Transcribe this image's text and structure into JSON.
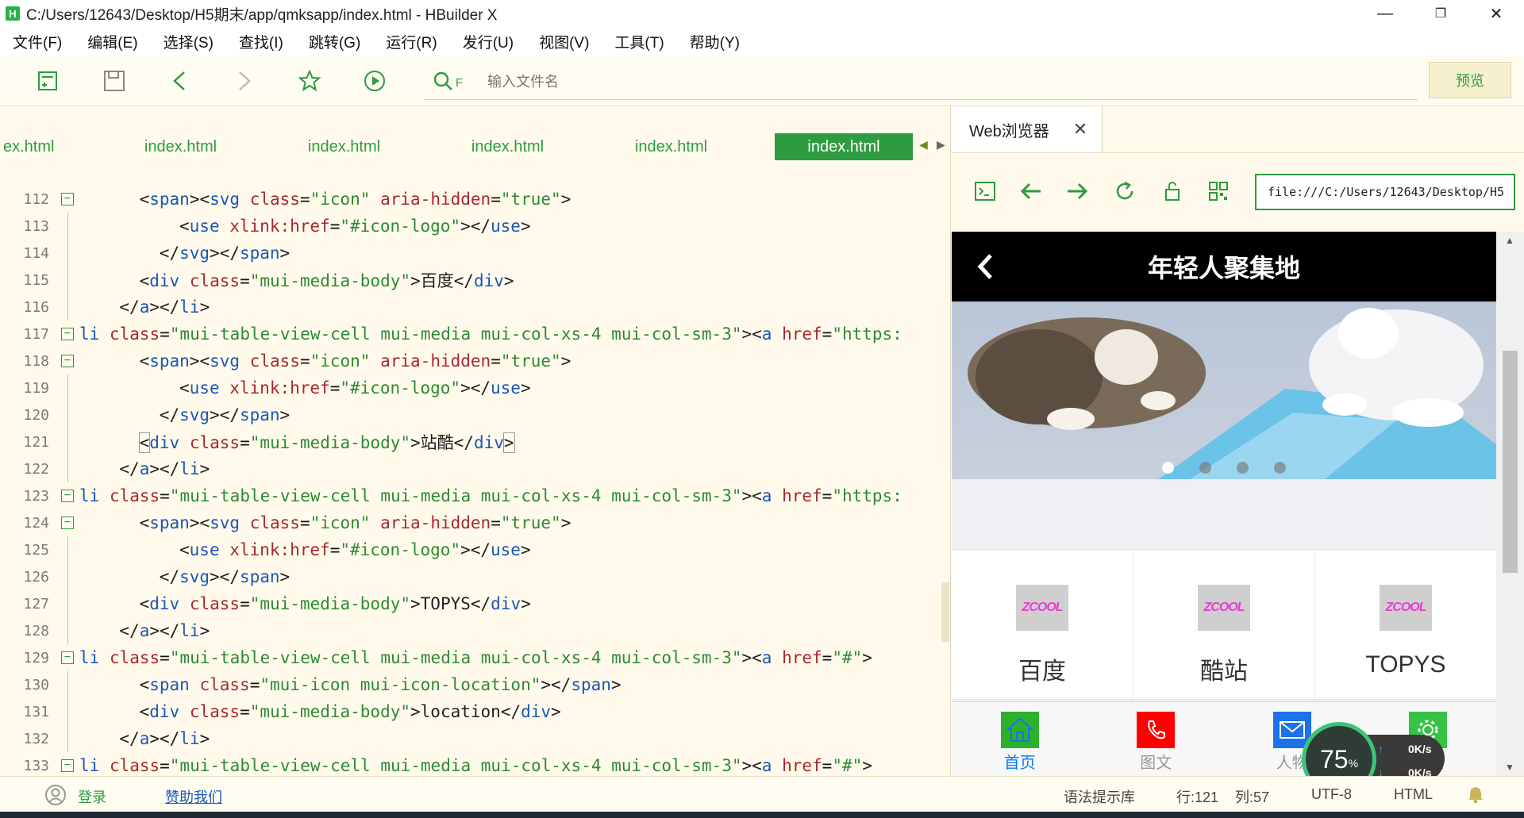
{
  "window": {
    "title": "C:/Users/12643/Desktop/H5期末/app/qmksapp/index.html - HBuilder X",
    "minimize": "—",
    "restore": "❐",
    "close": "✕"
  },
  "menu": [
    "文件(F)",
    "编辑(E)",
    "选择(S)",
    "查找(I)",
    "跳转(G)",
    "运行(R)",
    "发行(U)",
    "视图(V)",
    "工具(T)",
    "帮助(Y)"
  ],
  "toolbar": {
    "search_icon_text": "F",
    "search_placeholder": "输入文件名",
    "preview_label": "预览"
  },
  "tabs": [
    "ex.html",
    "index.html",
    "index.html",
    "index.html",
    "index.html",
    "index.html"
  ],
  "active_tab_index": 5,
  "code_lines": [
    {
      "n": "112",
      "fold": "−",
      "indent": 3,
      "html": "<span class=\"p\">&lt;</span><span class=\"t\">span</span><span class=\"p\">&gt;&lt;</span><span class=\"t\">svg</span> <span class=\"a\">class</span>=<span class=\"s\">\"icon\"</span> <span class=\"a\">aria-hidden</span>=<span class=\"s\">\"true\"</span><span class=\"p\">&gt;</span>"
    },
    {
      "n": "113",
      "fold": "",
      "indent": 5,
      "html": "<span class=\"p\">&lt;</span><span class=\"t\">use</span> <span class=\"a\">xlink:href</span>=<span class=\"s\">\"#icon-logo\"</span><span class=\"p\">&gt;&lt;/</span><span class=\"t\">use</span><span class=\"p\">&gt;</span>"
    },
    {
      "n": "114",
      "fold": "",
      "indent": 4,
      "html": "<span class=\"p\">&lt;/</span><span class=\"t\">svg</span><span class=\"p\">&gt;&lt;/</span><span class=\"t\">span</span><span class=\"p\">&gt;</span>"
    },
    {
      "n": "115",
      "fold": "",
      "indent": 3,
      "html": "<span class=\"p\">&lt;</span><span class=\"t\">div</span> <span class=\"a\">class</span>=<span class=\"s\">\"mui-media-body\"</span><span class=\"p\">&gt;百度&lt;/</span><span class=\"t\">div</span><span class=\"p\">&gt;</span>"
    },
    {
      "n": "116",
      "fold": "",
      "indent": 2,
      "html": "<span class=\"p\">&lt;/</span><span class=\"t\">a</span><span class=\"p\">&gt;&lt;/</span><span class=\"t\">li</span><span class=\"p\">&gt;</span>"
    },
    {
      "n": "117",
      "fold": "−",
      "indent": 0,
      "html": "<span class=\"t\">li</span> <span class=\"a\">class</span>=<span class=\"s\">\"mui-table-view-cell mui-media mui-col-xs-4 mui-col-sm-3\"</span><span class=\"p\">&gt;&lt;</span><span class=\"t\">a</span> <span class=\"a\">href</span>=<span class=\"s\">\"https:</span>"
    },
    {
      "n": "118",
      "fold": "−",
      "indent": 3,
      "html": "<span class=\"p\">&lt;</span><span class=\"t\">span</span><span class=\"p\">&gt;&lt;</span><span class=\"t\">svg</span> <span class=\"a\">class</span>=<span class=\"s\">\"icon\"</span> <span class=\"a\">aria-hidden</span>=<span class=\"s\">\"true\"</span><span class=\"p\">&gt;</span>"
    },
    {
      "n": "119",
      "fold": "",
      "indent": 5,
      "html": "<span class=\"p\">&lt;</span><span class=\"t\">use</span> <span class=\"a\">xlink:href</span>=<span class=\"s\">\"#icon-logo\"</span><span class=\"p\">&gt;&lt;/</span><span class=\"t\">use</span><span class=\"p\">&gt;</span>"
    },
    {
      "n": "120",
      "fold": "",
      "indent": 4,
      "html": "<span class=\"p\">&lt;/</span><span class=\"t\">svg</span><span class=\"p\">&gt;&lt;/</span><span class=\"t\">span</span><span class=\"p\">&gt;</span>"
    },
    {
      "n": "121",
      "fold": "",
      "indent": 3,
      "html": "<span class=\"p\" style=\"outline:1px solid #999\">&lt;</span><span class=\"t\">div</span> <span class=\"a\">class</span>=<span class=\"s\">\"mui-media-body\"</span><span class=\"p\">&gt;站酷&lt;/</span><span class=\"t\">div</span><span class=\"p\" style=\"outline:1px solid #999\">&gt;</span>"
    },
    {
      "n": "122",
      "fold": "",
      "indent": 2,
      "html": "<span class=\"p\">&lt;/</span><span class=\"t\">a</span><span class=\"p\">&gt;&lt;/</span><span class=\"t\">li</span><span class=\"p\">&gt;</span>"
    },
    {
      "n": "123",
      "fold": "−",
      "indent": 0,
      "html": "<span class=\"t\">li</span> <span class=\"a\">class</span>=<span class=\"s\">\"mui-table-view-cell mui-media mui-col-xs-4 mui-col-sm-3\"</span><span class=\"p\">&gt;&lt;</span><span class=\"t\">a</span> <span class=\"a\">href</span>=<span class=\"s\">\"https:</span>"
    },
    {
      "n": "124",
      "fold": "−",
      "indent": 3,
      "html": "<span class=\"p\">&lt;</span><span class=\"t\">span</span><span class=\"p\">&gt;&lt;</span><span class=\"t\">svg</span> <span class=\"a\">class</span>=<span class=\"s\">\"icon\"</span> <span class=\"a\">aria-hidden</span>=<span class=\"s\">\"true\"</span><span class=\"p\">&gt;</span>"
    },
    {
      "n": "125",
      "fold": "",
      "indent": 5,
      "html": "<span class=\"p\">&lt;</span><span class=\"t\">use</span> <span class=\"a\">xlink:href</span>=<span class=\"s\">\"#icon-logo\"</span><span class=\"p\">&gt;&lt;/</span><span class=\"t\">use</span><span class=\"p\">&gt;</span>"
    },
    {
      "n": "126",
      "fold": "",
      "indent": 4,
      "html": "<span class=\"p\">&lt;/</span><span class=\"t\">svg</span><span class=\"p\">&gt;&lt;/</span><span class=\"t\">span</span><span class=\"p\">&gt;</span>"
    },
    {
      "n": "127",
      "fold": "",
      "indent": 3,
      "html": "<span class=\"p\">&lt;</span><span class=\"t\">div</span> <span class=\"a\">class</span>=<span class=\"s\">\"mui-media-body\"</span><span class=\"p\">&gt;TOPYS&lt;/</span><span class=\"t\">div</span><span class=\"p\">&gt;</span>"
    },
    {
      "n": "128",
      "fold": "",
      "indent": 2,
      "html": "<span class=\"p\">&lt;/</span><span class=\"t\">a</span><span class=\"p\">&gt;&lt;/</span><span class=\"t\">li</span><span class=\"p\">&gt;</span>"
    },
    {
      "n": "129",
      "fold": "−",
      "indent": 0,
      "html": "<span class=\"t\">li</span> <span class=\"a\">class</span>=<span class=\"s\">\"mui-table-view-cell mui-media mui-col-xs-4 mui-col-sm-3\"</span><span class=\"p\">&gt;&lt;</span><span class=\"t\">a</span> <span class=\"a\">href</span>=<span class=\"s\">\"#\"</span><span class=\"p\">&gt;</span>"
    },
    {
      "n": "130",
      "fold": "",
      "indent": 3,
      "html": "<span class=\"p\">&lt;</span><span class=\"t\">span</span> <span class=\"a\">class</span>=<span class=\"s\">\"mui-icon mui-icon-location\"</span><span class=\"p\">&gt;&lt;/</span><span class=\"t\">span</span><span class=\"p\">&gt;</span>"
    },
    {
      "n": "131",
      "fold": "",
      "indent": 3,
      "html": "<span class=\"p\">&lt;</span><span class=\"t\">div</span> <span class=\"a\">class</span>=<span class=\"s\">\"mui-media-body\"</span><span class=\"p\">&gt;location&lt;/</span><span class=\"t\">div</span><span class=\"p\">&gt;</span>"
    },
    {
      "n": "132",
      "fold": "",
      "indent": 2,
      "html": "<span class=\"p\">&lt;/</span><span class=\"t\">a</span><span class=\"p\">&gt;&lt;/</span><span class=\"t\">li</span><span class=\"p\">&gt;</span>"
    },
    {
      "n": "133",
      "fold": "−",
      "indent": 0,
      "html": "<span class=\"t\">li</span> <span class=\"a\">class</span>=<span class=\"s\">\"mui-table-view-cell mui-media mui-col-xs-4 mui-col-sm-3\"</span><span class=\"p\">&gt;&lt;</span><span class=\"t\">a</span> <span class=\"a\">href</span>=<span class=\"s\">\"#\"</span><span class=\"p\">&gt;</span>"
    }
  ],
  "browser": {
    "tab_label": "Web浏览器",
    "tab_close": "✕",
    "url": "file:///C:/Users/12643/Desktop/H5"
  },
  "phone": {
    "header_title": "年轻人聚集地",
    "banner_dots": 4,
    "banner_active_dot": 0,
    "grid": [
      {
        "logo": "ZCOOL",
        "label": "百度"
      },
      {
        "logo": "ZCOOL",
        "label": "酷站"
      },
      {
        "logo": "ZCOOL",
        "label": "TOPYS"
      }
    ],
    "tabbar": [
      {
        "label": "首页",
        "color": "#2db02d",
        "icon": "home-icon",
        "active": true
      },
      {
        "label": "图文",
        "color": "#ff0000",
        "icon": "phone-icon",
        "active": false
      },
      {
        "label": "人物",
        "color": "#1a73e8",
        "icon": "mail-icon",
        "active": false
      },
      {
        "label": "设置",
        "color": "#36c245",
        "icon": "gear-icon",
        "active": false
      }
    ]
  },
  "speed_widget": {
    "percent": "75",
    "percent_unit": "%",
    "up_rate": "0K/s",
    "down_rate": "0K/s"
  },
  "status": {
    "login": "登录",
    "sponsor": "赞助我们",
    "syntax_lib": "语法提示库",
    "row": "行:121",
    "col": "列:57",
    "encoding": "UTF-8",
    "language": "HTML"
  },
  "colors": {
    "accent_green": "#2d9c40",
    "editor_bg": "#fffaeb"
  }
}
